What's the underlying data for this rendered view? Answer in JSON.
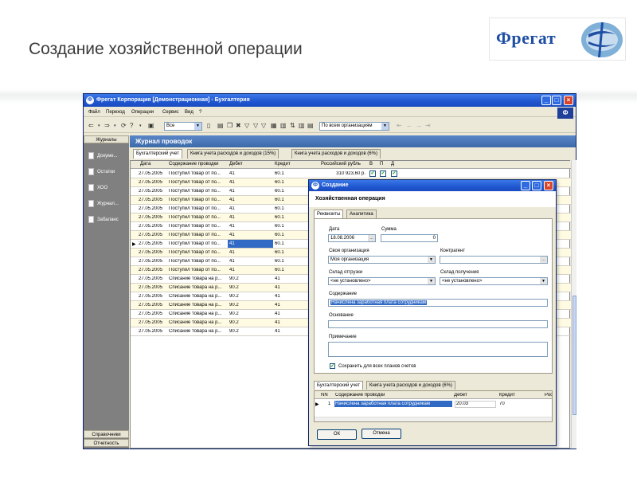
{
  "slide": {
    "title": "Создание хозяйственной операции",
    "logo_text": "Фрегат"
  },
  "window": {
    "title": "Фрегат Корпорация [Демонстрационная] - Бухгалтерия",
    "menu": [
      "Файл",
      "Переход",
      "Операции",
      "Сервис",
      "Вид",
      "?"
    ],
    "toolbar": {
      "filter_value": "Все",
      "org_value": "По всем организациям"
    }
  },
  "nav": {
    "header": "Журналы",
    "items": [
      "Докуме...",
      "Остатки",
      "ХОО",
      "Журнал...",
      "Забаланс"
    ],
    "bottom": [
      "Справочники",
      "Отчетность"
    ]
  },
  "journal": {
    "title": "Журнал проводок",
    "tabs": [
      "Бухгалтерский учет",
      "Книга учета расходов и доходов (15%)",
      "Книга учета расходов и доходов (6%)"
    ],
    "columns": [
      "Дата",
      "Содержание проводки",
      "Дебет",
      "Кредит",
      "Российский рубль",
      "В",
      "П",
      "Д"
    ],
    "rows": [
      {
        "date": "27.05.2005",
        "text": "Поступил товар от по...",
        "debit": "41",
        "credit": "60.1",
        "amount": "310 923,60 р."
      },
      {
        "date": "27.05.2005",
        "text": "Поступил товар от по...",
        "debit": "41",
        "credit": "60.1",
        "amount": ""
      },
      {
        "date": "27.05.2005",
        "text": "Поступил товар от по...",
        "debit": "41",
        "credit": "60.1",
        "amount": ""
      },
      {
        "date": "27.05.2005",
        "text": "Поступил товар от по...",
        "debit": "41",
        "credit": "60.1",
        "amount": ""
      },
      {
        "date": "27.05.2005",
        "text": "Поступил товар от по...",
        "debit": "41",
        "credit": "60.1",
        "amount": ""
      },
      {
        "date": "27.05.2005",
        "text": "Поступил товар от по...",
        "debit": "41",
        "credit": "60.1",
        "amount": ""
      },
      {
        "date": "27.05.2005",
        "text": "Поступил товар от по...",
        "debit": "41",
        "credit": "60.1",
        "amount": ""
      },
      {
        "date": "27.05.2005",
        "text": "Поступил товар от по...",
        "debit": "41",
        "credit": "60.1",
        "amount": ""
      },
      {
        "date": "27.05.2005",
        "text": "Поступил товар от по...",
        "debit": "41",
        "credit": "60.1",
        "amount": ""
      },
      {
        "date": "27.05.2005",
        "text": "Поступил товар от по...",
        "debit": "41",
        "credit": "60.1",
        "amount": ""
      },
      {
        "date": "27.05.2005",
        "text": "Поступил товар от по...",
        "debit": "41",
        "credit": "60.1",
        "amount": ""
      },
      {
        "date": "27.05.2005",
        "text": "Поступил товар от по...",
        "debit": "41",
        "credit": "60.1",
        "amount": ""
      },
      {
        "date": "27.05.2005",
        "text": "Списание товара на р...",
        "debit": "90.2",
        "credit": "41",
        "amount": ""
      },
      {
        "date": "27.05.2005",
        "text": "Списание товара на р...",
        "debit": "90.2",
        "credit": "41",
        "amount": ""
      },
      {
        "date": "27.05.2005",
        "text": "Списание товара на р...",
        "debit": "90.2",
        "credit": "41",
        "amount": ""
      },
      {
        "date": "27.05.2005",
        "text": "Списание товара на р...",
        "debit": "90.2",
        "credit": "41",
        "amount": ""
      },
      {
        "date": "27.05.2005",
        "text": "Списание товара на р...",
        "debit": "90.2",
        "credit": "41",
        "amount": ""
      },
      {
        "date": "27.05.2005",
        "text": "Списание товара на р...",
        "debit": "90.2",
        "credit": "41",
        "amount": ""
      },
      {
        "date": "27.05.2005",
        "text": "Списание товара на р...",
        "debit": "90.2",
        "credit": "41",
        "amount": ""
      }
    ],
    "selected_row": 8
  },
  "dialog": {
    "title": "Создание",
    "subtitle": "Хозяйственная операция",
    "tabs": [
      "Реквизиты",
      "Аналитика"
    ],
    "labels": {
      "date": "Дата",
      "sum": "Сумма",
      "own_org": "Своя организация",
      "counterparty": "Контрагент",
      "ship_warehouse": "Склад отгрузки",
      "recv_warehouse": "Склад получения",
      "content": "Содержание",
      "basis": "Основание",
      "note": "Примечание",
      "save_all": "Сохранить для всех планов счетов"
    },
    "values": {
      "date": "18.08.2006",
      "sum": "0",
      "own_org": "Моя организация",
      "counterparty": "",
      "ship_warehouse": "<не установлено>",
      "recv_warehouse": "<не установлено>",
      "content": "Начислена заработная плата сотрудникам",
      "basis": "",
      "note": ""
    },
    "bottom_tabs": [
      "Бухгалтерский учет",
      "Книга учета расходов и доходов (6%)"
    ],
    "bottom_columns": [
      "NN",
      "Содержание проводки",
      "Дебет",
      "Кредит",
      "Росс"
    ],
    "bottom_row": {
      "nn": "1",
      "text": "Начислена заработная плата сотрудникам",
      "debit": "20.03",
      "credit": "70"
    },
    "ok_label": "ОК",
    "cancel_label": "Отмена"
  }
}
